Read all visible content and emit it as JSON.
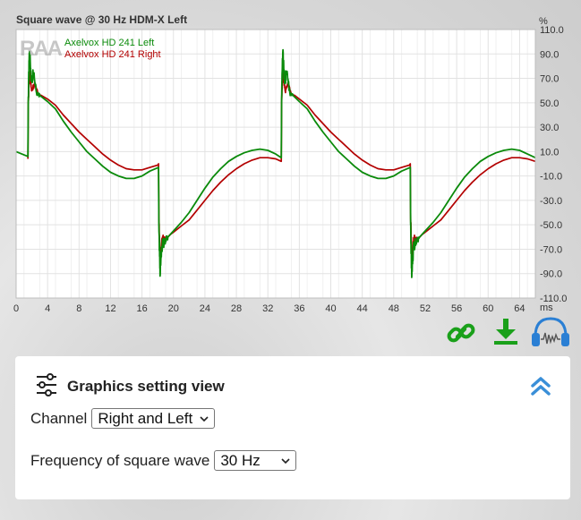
{
  "chart_data": {
    "type": "line",
    "title": "Square wave @ 30 Hz HDM-X Left",
    "xlabel": "ms",
    "ylabel": "%",
    "xlim": [
      0,
      66
    ],
    "ylim": [
      -110,
      110
    ],
    "x_ticks": [
      0,
      4,
      8,
      12,
      16,
      20,
      24,
      28,
      32,
      36,
      40,
      44,
      48,
      52,
      56,
      60,
      64
    ],
    "x_tick_labels": [
      "0",
      "4",
      "8",
      "12",
      "16",
      "20",
      "24",
      "28",
      "32",
      "36",
      "40",
      "44",
      "48",
      "52",
      "56",
      "60",
      "64"
    ],
    "y_ticks": [
      110,
      90,
      70,
      50,
      30,
      10,
      -10,
      -30,
      -50,
      -70,
      -90,
      -110
    ],
    "y_tick_labels": [
      "110.0",
      "90.0",
      "70.0",
      "50.0",
      "30.0",
      "10.0",
      "-10.0",
      "-30.0",
      "-50.0",
      "-70.0",
      "-90.0",
      "-110.0"
    ],
    "grid": true,
    "legend_position": "top-left",
    "series": [
      {
        "name": "Axelvox HD 241 Left",
        "color": "#0a8a0a",
        "points": [
          [
            0,
            10
          ],
          [
            1.5,
            6
          ],
          [
            1.55,
            55
          ],
          [
            1.7,
            92
          ],
          [
            1.9,
            68
          ],
          [
            2.2,
            74
          ],
          [
            2.6,
            58
          ],
          [
            3,
            56
          ],
          [
            4,
            51
          ],
          [
            5,
            45
          ],
          [
            6,
            35
          ],
          [
            7,
            26
          ],
          [
            8,
            18
          ],
          [
            9,
            10
          ],
          [
            10,
            4
          ],
          [
            11,
            -2
          ],
          [
            12,
            -7
          ],
          [
            13,
            -10
          ],
          [
            14,
            -12
          ],
          [
            15,
            -12
          ],
          [
            16,
            -10
          ],
          [
            17,
            -6
          ],
          [
            18.1,
            -3
          ],
          [
            18.15,
            -50
          ],
          [
            18.3,
            -92
          ],
          [
            18.5,
            -68
          ],
          [
            18.8,
            -65
          ],
          [
            19.3,
            -60
          ],
          [
            20,
            -55
          ],
          [
            21,
            -48
          ],
          [
            22,
            -40
          ],
          [
            23,
            -30
          ],
          [
            24,
            -20
          ],
          [
            25,
            -11
          ],
          [
            26,
            -4
          ],
          [
            27,
            2
          ],
          [
            28,
            6
          ],
          [
            29,
            9
          ],
          [
            30,
            11
          ],
          [
            31,
            12
          ],
          [
            32,
            11
          ],
          [
            33,
            8
          ],
          [
            33.7,
            5
          ],
          [
            33.75,
            55
          ],
          [
            33.9,
            91
          ],
          [
            34.1,
            68
          ],
          [
            34.4,
            74
          ],
          [
            34.8,
            58
          ],
          [
            35.2,
            56
          ],
          [
            36,
            51
          ],
          [
            37,
            45
          ],
          [
            38,
            35
          ],
          [
            39,
            26
          ],
          [
            40,
            18
          ],
          [
            41,
            10
          ],
          [
            42,
            4
          ],
          [
            43,
            -2
          ],
          [
            44,
            -7
          ],
          [
            45,
            -10
          ],
          [
            46,
            -12
          ],
          [
            47,
            -12
          ],
          [
            48,
            -10
          ],
          [
            49,
            -6
          ],
          [
            50.1,
            -3
          ],
          [
            50.15,
            -50
          ],
          [
            50.3,
            -92
          ],
          [
            50.5,
            -68
          ],
          [
            50.8,
            -65
          ],
          [
            51.3,
            -60
          ],
          [
            52,
            -55
          ],
          [
            53,
            -48
          ],
          [
            54,
            -40
          ],
          [
            55,
            -30
          ],
          [
            56,
            -20
          ],
          [
            57,
            -11
          ],
          [
            58,
            -4
          ],
          [
            59,
            2
          ],
          [
            60,
            6
          ],
          [
            61,
            9
          ],
          [
            62,
            11
          ],
          [
            63,
            12
          ],
          [
            64,
            11
          ],
          [
            65,
            8
          ],
          [
            66,
            5
          ]
        ]
      },
      {
        "name": "Axelvox HD 241 Right",
        "color": "#b30000",
        "points": [
          [
            1.5,
            4
          ],
          [
            1.55,
            50
          ],
          [
            1.7,
            76
          ],
          [
            2,
            60
          ],
          [
            2.4,
            66
          ],
          [
            2.8,
            57
          ],
          [
            3.2,
            56
          ],
          [
            4,
            53
          ],
          [
            5,
            48
          ],
          [
            6,
            40
          ],
          [
            7,
            33
          ],
          [
            8,
            26
          ],
          [
            9,
            20
          ],
          [
            10,
            14
          ],
          [
            11,
            8
          ],
          [
            12,
            3
          ],
          [
            13,
            -1
          ],
          [
            14,
            -4
          ],
          [
            15,
            -5
          ],
          [
            16,
            -5
          ],
          [
            17,
            -3
          ],
          [
            18,
            -1
          ],
          [
            18.1,
            0
          ],
          [
            18.15,
            -45
          ],
          [
            18.3,
            -76
          ],
          [
            18.6,
            -60
          ],
          [
            19,
            -62
          ],
          [
            19.6,
            -58
          ],
          [
            20,
            -56
          ],
          [
            21,
            -51
          ],
          [
            22,
            -46
          ],
          [
            23,
            -38
          ],
          [
            24,
            -30
          ],
          [
            25,
            -22
          ],
          [
            26,
            -15
          ],
          [
            27,
            -9
          ],
          [
            28,
            -4
          ],
          [
            29,
            0
          ],
          [
            30,
            3
          ],
          [
            31,
            5
          ],
          [
            32,
            5
          ],
          [
            33,
            4
          ],
          [
            33.7,
            2
          ],
          [
            33.75,
            50
          ],
          [
            33.9,
            76
          ],
          [
            34.2,
            60
          ],
          [
            34.6,
            66
          ],
          [
            35,
            57
          ],
          [
            35.4,
            56
          ],
          [
            36,
            53
          ],
          [
            37,
            48
          ],
          [
            38,
            40
          ],
          [
            39,
            33
          ],
          [
            40,
            26
          ],
          [
            41,
            20
          ],
          [
            42,
            14
          ],
          [
            43,
            8
          ],
          [
            44,
            3
          ],
          [
            45,
            -1
          ],
          [
            46,
            -4
          ],
          [
            47,
            -5
          ],
          [
            48,
            -5
          ],
          [
            49,
            -3
          ],
          [
            50,
            -1
          ],
          [
            50.1,
            0
          ],
          [
            50.15,
            -45
          ],
          [
            50.3,
            -76
          ],
          [
            50.6,
            -60
          ],
          [
            51,
            -62
          ],
          [
            51.6,
            -58
          ],
          [
            52,
            -56
          ],
          [
            53,
            -51
          ],
          [
            54,
            -46
          ],
          [
            55,
            -38
          ],
          [
            56,
            -30
          ],
          [
            57,
            -22
          ],
          [
            58,
            -15
          ],
          [
            59,
            -9
          ],
          [
            60,
            -4
          ],
          [
            61,
            0
          ],
          [
            62,
            3
          ],
          [
            63,
            5
          ],
          [
            64,
            5
          ],
          [
            65,
            4
          ],
          [
            66,
            2
          ]
        ]
      }
    ],
    "ringing": [
      {
        "series": 0,
        "start": 1.55,
        "end": 3.0,
        "amplitude": 8
      },
      {
        "series": 0,
        "start": 18.15,
        "end": 19.6,
        "amplitude": 8
      },
      {
        "series": 0,
        "start": 33.75,
        "end": 35.2,
        "amplitude": 8
      },
      {
        "series": 0,
        "start": 50.15,
        "end": 51.6,
        "amplitude": 8
      },
      {
        "series": 1,
        "start": 1.55,
        "end": 2.8,
        "amplitude": 4
      },
      {
        "series": 1,
        "start": 18.15,
        "end": 19.4,
        "amplitude": 4
      },
      {
        "series": 1,
        "start": 33.75,
        "end": 35.0,
        "amplitude": 4
      },
      {
        "series": 1,
        "start": 50.15,
        "end": 51.4,
        "amplitude": 4
      }
    ]
  },
  "panel": {
    "title": "Graphics setting view",
    "channel_label": "Channel",
    "channel_value": "Right and Left",
    "frequency_label": "Frequency of square wave",
    "frequency_value": "30 Hz"
  },
  "icons": {
    "accent": "#1aa01a",
    "headphone_blue": "#2a7fd4",
    "collapse_blue": "#3a8fd8"
  }
}
